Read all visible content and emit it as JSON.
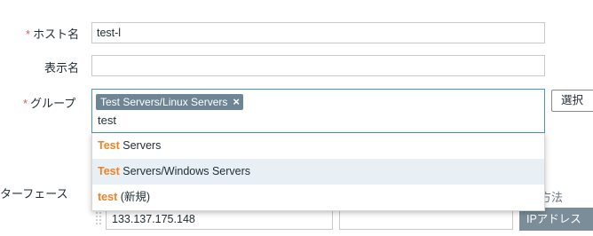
{
  "form": {
    "host_name": {
      "required_mark": "*",
      "label": "ホスト名",
      "value": "test-l"
    },
    "display_name": {
      "label": "表示名",
      "value": ""
    },
    "groups": {
      "required_mark": "*",
      "label": "グループ",
      "selected": [
        "Test Servers/Linux Servers"
      ],
      "remove_symbol": "×",
      "typed_text": "test",
      "select_button": "選択"
    },
    "interfaces": {
      "label": "ターフェース",
      "method_header": "方法",
      "ip_value": "133.137.175.148",
      "ip_button": "IPアドレス"
    }
  },
  "suggestions": [
    {
      "match": "Test",
      "rest": " Servers",
      "highlighted": false
    },
    {
      "match": "Test",
      "rest": " Servers/Windows Servers",
      "highlighted": true
    },
    {
      "match": "test",
      "rest": " (新規)",
      "highlighted": false
    }
  ],
  "colors": {
    "required": "#e45959",
    "match": "#f48024",
    "chip_bg": "#6d8594",
    "focus_border": "#4796c4",
    "highlight_row": "#e8f0f6"
  }
}
